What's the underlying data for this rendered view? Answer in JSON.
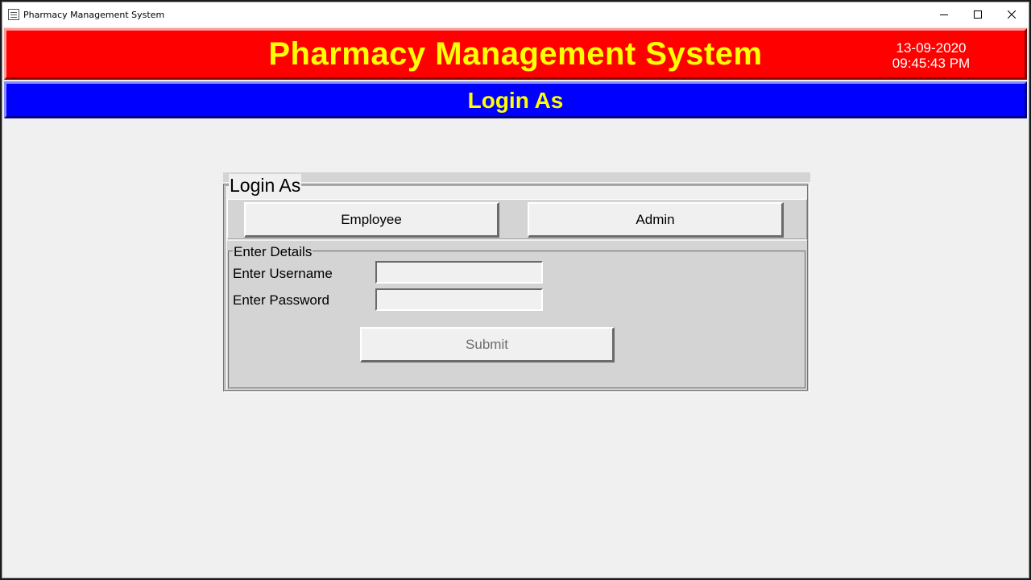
{
  "window": {
    "title": "Pharmacy Management System",
    "icon": "app-form-icon",
    "controls": [
      "minimize-icon",
      "maximize-icon",
      "close-icon"
    ]
  },
  "header": {
    "title": "Pharmacy Management System",
    "date": "13-09-2020",
    "time": "09:45:43 PM",
    "background": "#ff0000",
    "title_color": "#ffff00"
  },
  "subheader": {
    "title": "Login As",
    "background": "#0000ff",
    "title_color": "#ffff00"
  },
  "login_frame": {
    "label": "Login As",
    "buttons": {
      "employee": "Employee",
      "admin": "Admin"
    }
  },
  "details": {
    "label": "Enter Details",
    "username_label": "Enter Username",
    "password_label": "Enter Password",
    "username_value": "",
    "password_value": "",
    "submit_label": "Submit",
    "submit_state": "disabled"
  }
}
